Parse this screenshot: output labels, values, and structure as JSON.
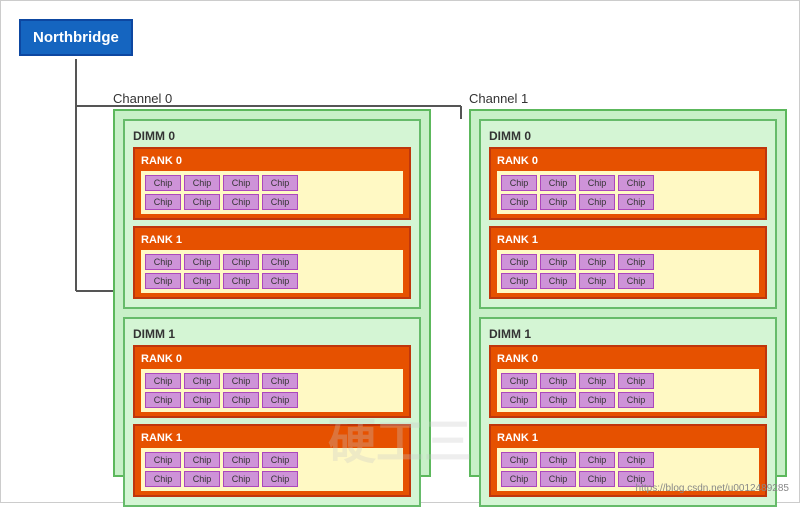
{
  "northbridge": {
    "label": "Northbridge"
  },
  "channels": [
    {
      "id": "channel0",
      "label": "Channel 0",
      "dimms": [
        {
          "label": "DIMM 0",
          "ranks": [
            {
              "label": "RANK 0",
              "rows": [
                [
                  "Chip",
                  "Chip",
                  "Chip",
                  "Chip"
                ],
                [
                  "Chip",
                  "Chip",
                  "Chip",
                  "Chip"
                ]
              ]
            },
            {
              "label": "RANK 1",
              "rows": [
                [
                  "Chip",
                  "Chip",
                  "Chip",
                  "Chip"
                ],
                [
                  "Chip",
                  "Chip",
                  "Chip",
                  "Chip"
                ]
              ]
            }
          ]
        },
        {
          "label": "DIMM 1",
          "ranks": [
            {
              "label": "RANK 0",
              "rows": [
                [
                  "Chip",
                  "Chip",
                  "Chip",
                  "Chip"
                ],
                [
                  "Chip",
                  "Chip",
                  "Chip",
                  "Chip"
                ]
              ]
            },
            {
              "label": "RANK 1",
              "rows": [
                [
                  "Chip",
                  "Chip",
                  "Chip",
                  "Chip"
                ],
                [
                  "Chip",
                  "Chip",
                  "Chip",
                  "Chip"
                ]
              ]
            }
          ]
        }
      ]
    },
    {
      "id": "channel1",
      "label": "Channel 1",
      "dimms": [
        {
          "label": "DIMM 0",
          "ranks": [
            {
              "label": "RANK 0",
              "rows": [
                [
                  "Chip",
                  "Chip",
                  "Chip",
                  "Chip"
                ],
                [
                  "Chip",
                  "Chip",
                  "Chip",
                  "Chip"
                ]
              ]
            },
            {
              "label": "RANK 1",
              "rows": [
                [
                  "Chip",
                  "Chip",
                  "Chip",
                  "Chip"
                ],
                [
                  "Chip",
                  "Chip",
                  "Chip",
                  "Chip"
                ]
              ]
            }
          ]
        },
        {
          "label": "DIMM 1",
          "ranks": [
            {
              "label": "RANK 0",
              "rows": [
                [
                  "Chip",
                  "Chip",
                  "Chip",
                  "Chip"
                ],
                [
                  "Chip",
                  "Chip",
                  "Chip",
                  "Chip"
                ]
              ]
            },
            {
              "label": "RANK 1",
              "rows": [
                [
                  "Chip",
                  "Chip",
                  "Chip",
                  "Chip"
                ],
                [
                  "Chip",
                  "Chip",
                  "Chip",
                  "Chip"
                ]
              ]
            }
          ]
        }
      ]
    }
  ],
  "watermark": "硬工三",
  "url": "https://blog.csdn.net/u0012489285"
}
